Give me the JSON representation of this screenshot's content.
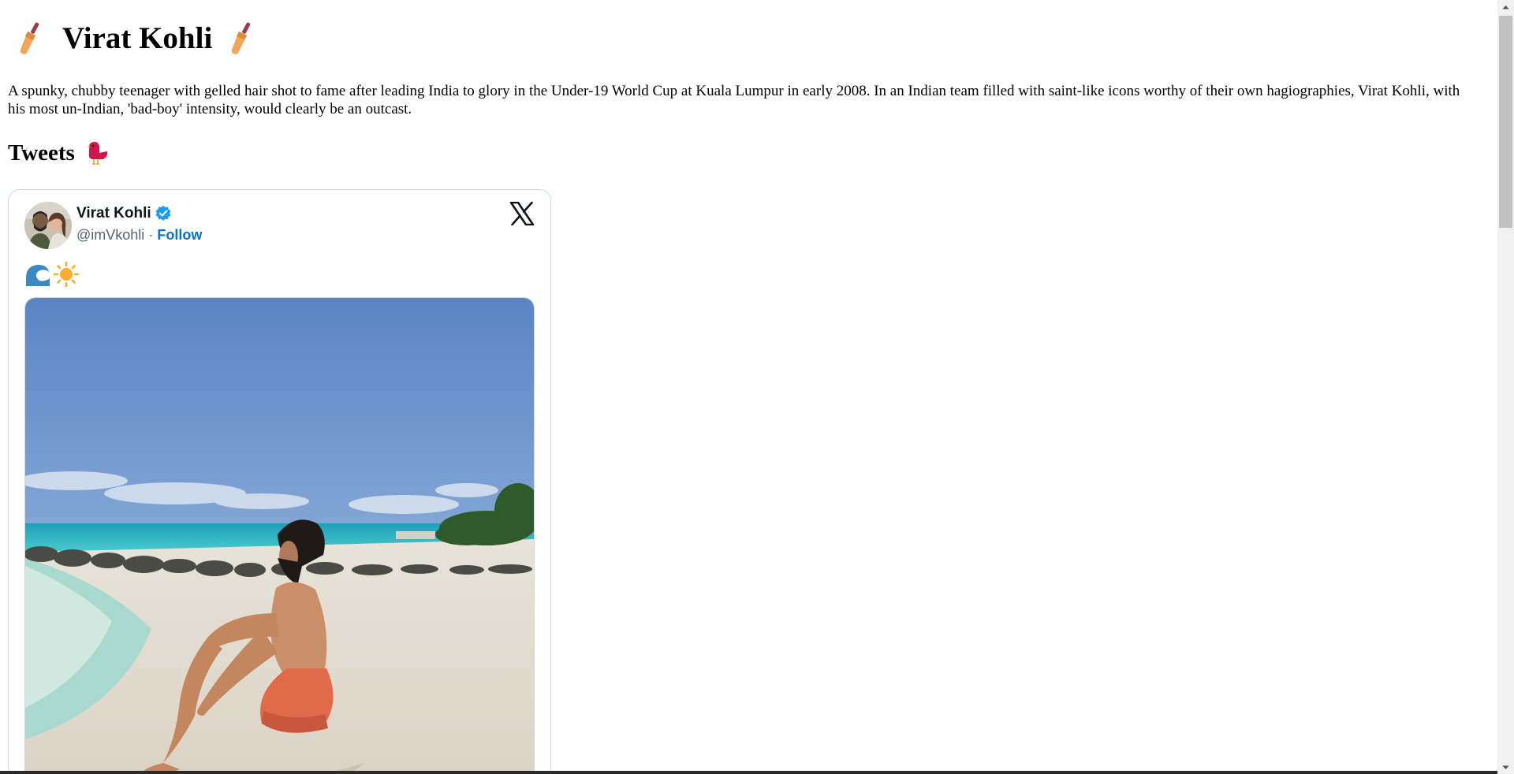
{
  "page": {
    "title": "Virat Kohli",
    "title_icon": "cricket-bat-icon",
    "intro": "A spunky, chubby teenager with gelled hair shot to fame after leading India to glory in the Under-19 World Cup at Kuala Lumpur in early 2008. In an Indian team filled with saint-like icons worthy of their own hagiographies, Virat Kohli, with his most un-Indian, 'bad-boy' intensity, would clearly be an outcast.",
    "tweets_heading": "Tweets",
    "tweets_icon": "bird-icon"
  },
  "tweet": {
    "author_name": "Virat Kohli",
    "handle": "@imVkohli",
    "separator": "·",
    "follow_label": "Follow",
    "verified_icon": "verified-badge-icon",
    "brand_icon": "x-logo-icon",
    "text_emojis": [
      "wave-icon",
      "sun-icon"
    ],
    "media_description_icon": "beach-photo"
  },
  "colors": {
    "follow_link": "#0074d4",
    "handle_gray": "#536471",
    "verified_blue": "#1d9bf0",
    "card_border": "#cfd9de"
  }
}
